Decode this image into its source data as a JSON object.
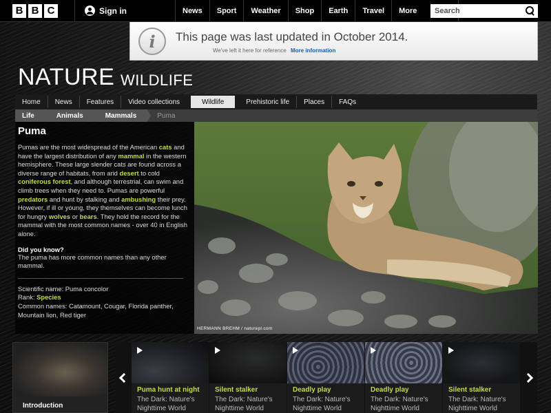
{
  "header": {
    "logo_letters": [
      "B",
      "B",
      "C"
    ],
    "signin_label": "Sign in",
    "nav": [
      "News",
      "Sport",
      "Weather",
      "Shop",
      "Earth",
      "Travel"
    ],
    "more_label": "More",
    "search_placeholder": "Search"
  },
  "notice": {
    "title": "This page was last updated in October 2014.",
    "subtitle": "We've left it here for reference",
    "link": "More information"
  },
  "page_title": {
    "main": "NATURE",
    "section": "WILDLIFE"
  },
  "section_nav": {
    "items": [
      "Home",
      "News",
      "Features",
      "Video collections",
      "Wildlife",
      "Prehistoric life",
      "Places",
      "FAQs"
    ],
    "active": "Wildlife"
  },
  "breadcrumb": {
    "items": [
      "Life",
      "Animals",
      "Mammals"
    ],
    "current": "Puma"
  },
  "article": {
    "heading": "Puma",
    "desc_parts": [
      {
        "t": "Pumas are the most widespread of the American "
      },
      {
        "t": "cats",
        "kw": true
      },
      {
        "t": " and have the largest distribution of any "
      },
      {
        "t": "mammal",
        "kw": true
      },
      {
        "t": " in the western hemisphere. These large slender cats are found across a diverse range of habitats, from arid "
      },
      {
        "t": "desert",
        "kw": true
      },
      {
        "t": " to cold "
      },
      {
        "t": "coniferous forest",
        "kw": true
      },
      {
        "t": ", and although terrestrial, can swim and climb trees when they need to. Pumas are powerful "
      },
      {
        "t": "predators",
        "kw": true
      },
      {
        "t": " and hunt by stalking and "
      },
      {
        "t": "ambushing",
        "kw": true
      },
      {
        "t": " their prey. However, if ill or young, they themselves can become lunch for hungry "
      },
      {
        "t": "wolves",
        "kw": true
      },
      {
        "t": " or "
      },
      {
        "t": "bears",
        "kw": true
      },
      {
        "t": ". They hold the record for the mammal with the most common names - over 40 in English alone."
      }
    ],
    "dyk_heading": "Did you know?",
    "dyk_text": "The puma has more common names than any other mammal.",
    "scientific_name": "Scientific name: Puma concolor",
    "rank_label": "Rank: ",
    "rank_value": "Species",
    "common_names": "Common names: Catamount, Cougar, Florida panther, Mountain lion, Red tiger"
  },
  "photo": {
    "credit": "HERMANN BREHM / naturepl.com"
  },
  "intro_tile": {
    "label": "Introduction"
  },
  "clips": [
    {
      "title": "Puma hunt at night",
      "sub": "The Dark: Nature's Nighttime World"
    },
    {
      "title": "Silent stalker",
      "sub": "The Dark: Nature's Nighttime World"
    },
    {
      "title": "Deadly play",
      "sub": "The Dark: Nature's Nighttime World"
    },
    {
      "title": "Deadly play",
      "sub": "The Dark: Nature's Nighttime World"
    },
    {
      "title": "Silent stalker",
      "sub": "The Dark: Nature's Nighttime World"
    }
  ],
  "colors": {
    "keyword": "#c8d94a",
    "link": "#1a5aad"
  }
}
